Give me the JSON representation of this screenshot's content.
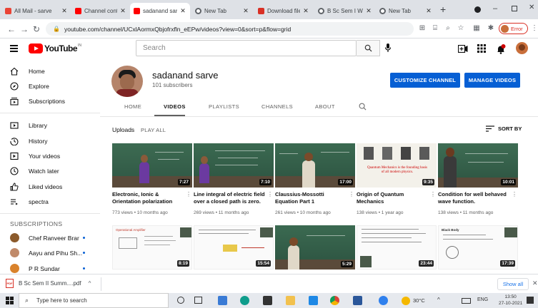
{
  "browser": {
    "tabs": [
      {
        "label": "All Mail - sarve",
        "favicon_color": "#ea4335",
        "active": false
      },
      {
        "label": "Channel conten",
        "favicon_color": "#ff0000",
        "active": false
      },
      {
        "label": "sadanand sarve",
        "favicon_color": "#ff0000",
        "active": true
      },
      {
        "label": "New Tab",
        "favicon_color": "#5f6368",
        "active": false
      },
      {
        "label": "Download file",
        "favicon_color": "#d93025",
        "active": false
      },
      {
        "label": "B Sc Sem I Wri",
        "favicon_color": "#5f6368",
        "active": false
      },
      {
        "label": "New Tab",
        "favicon_color": "#5f6368",
        "active": false
      }
    ],
    "url": "youtube.com/channel/UCxlAormxQbjofrxfln_eEPw/videos?view=0&sort=p&flow=grid",
    "profile_label": "Error"
  },
  "youtube": {
    "logo_text": "YouTube",
    "logo_country": "IN",
    "search_placeholder": "Search"
  },
  "sidebar": {
    "main": [
      {
        "label": "Home",
        "icon": "home-icon"
      },
      {
        "label": "Explore",
        "icon": "compass-icon"
      },
      {
        "label": "Subscriptions",
        "icon": "subscriptions-icon"
      }
    ],
    "library": [
      {
        "label": "Library",
        "icon": "library-icon"
      },
      {
        "label": "History",
        "icon": "history-icon"
      },
      {
        "label": "Your videos",
        "icon": "your-videos-icon"
      },
      {
        "label": "Watch later",
        "icon": "clock-icon"
      },
      {
        "label": "Liked videos",
        "icon": "thumbs-up-icon"
      },
      {
        "label": "spectra",
        "icon": "playlist-icon"
      }
    ],
    "subscriptions_heading": "SUBSCRIPTIONS",
    "subscriptions": [
      {
        "label": "Chef Ranveer Brar",
        "color": "#8b5a2b"
      },
      {
        "label": "Aayu and Pihu Sh...",
        "color": "#c08a6a"
      },
      {
        "label": "P R Sundar",
        "color": "#d9822b"
      }
    ]
  },
  "channel": {
    "name": "sadanand sarve",
    "subscribers": "101 subscribers",
    "customize_label": "CUSTOMIZE CHANNEL",
    "manage_label": "MANAGE VIDEOS",
    "tabs": [
      "HOME",
      "VIDEOS",
      "PLAYLISTS",
      "CHANNELS",
      "ABOUT"
    ],
    "active_tab": "VIDEOS"
  },
  "uploads": {
    "title": "Uploads",
    "play_all": "PLAY ALL",
    "sort_label": "SORT BY"
  },
  "videos_row1": [
    {
      "title_line1": "Electronic, Ionic &",
      "title_line2": "Orientation polarization",
      "meta": "773 views • 10 months ago",
      "duration": "7:27",
      "scene": "teacher"
    },
    {
      "title_line1": "Line integral of electric field",
      "title_line2": "over a closed path is zero.",
      "meta": "269 views • 11 months ago",
      "duration": "7:10",
      "scene": "teacher"
    },
    {
      "title_line1": "Claussius-Mossotti",
      "title_line2": "Equation Part 1",
      "meta": "261 views • 10 months ago",
      "duration": "17:00",
      "scene": "teacher"
    },
    {
      "title_line1": "Origin of Quantum",
      "title_line2": "Mechanics",
      "meta": "138 views • 1 year ago",
      "duration": "9:35",
      "scene": "slide",
      "slide_text": "Quantum Mechanics is the founding basis of all modern physics."
    },
    {
      "title_line1": "Condition for well behaved",
      "title_line2": "wave function.",
      "meta": "138 views • 11 months ago",
      "duration": "10:01",
      "scene": "teacher"
    }
  ],
  "videos_row2": [
    {
      "duration": "8:19",
      "scene": "slide",
      "slide_text": "Operational Amplifier"
    },
    {
      "duration": "15:54",
      "scene": "slide",
      "slide_text": ""
    },
    {
      "duration": "5:29",
      "scene": "teacher"
    },
    {
      "duration": "23:44",
      "scene": "slide",
      "slide_text": ""
    },
    {
      "duration": "17:39",
      "scene": "slide",
      "slide_text": "Black Body"
    }
  ],
  "downloads": {
    "file": "B Sc Sem II Summ....pdf",
    "show_all": "Show all"
  },
  "taskbar": {
    "search_placeholder": "Type here to search",
    "temperature": "30°C",
    "language": "ENG",
    "time": "13:50",
    "date": "27-10-2021"
  }
}
